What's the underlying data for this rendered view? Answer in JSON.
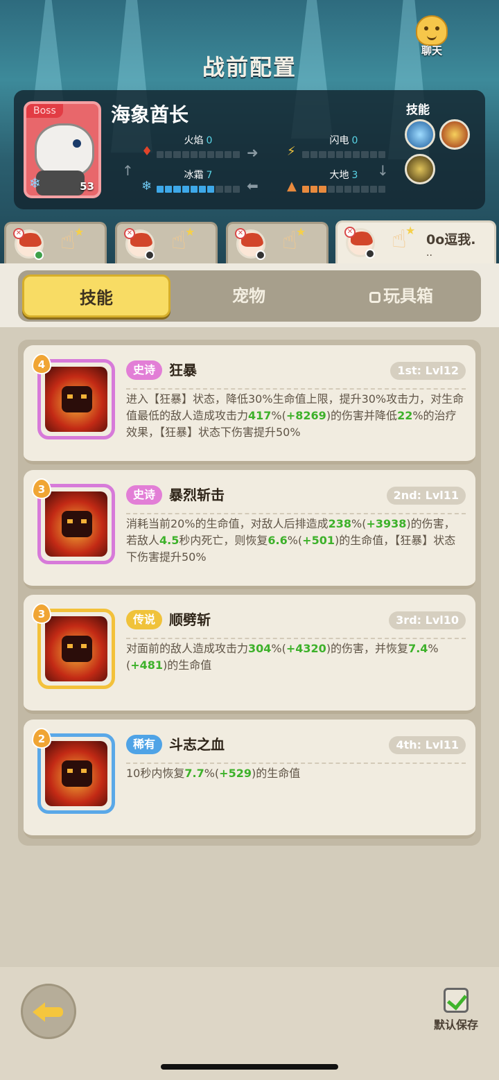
{
  "header": {
    "title": "战前配置",
    "chat_label": "聊天"
  },
  "boss": {
    "tag": "Boss",
    "name": "海象酋长",
    "level": "53",
    "skills_label": "技能",
    "stats": [
      {
        "label": "火焰",
        "value": "0",
        "filled": 0
      },
      {
        "label": "闪电",
        "value": "0",
        "filled": 0
      },
      {
        "label": "冰霜",
        "value": "7",
        "filled": 7
      },
      {
        "label": "大地",
        "value": "3",
        "filled": 3
      }
    ]
  },
  "heroes": [
    {
      "name": ""
    },
    {
      "name": ""
    },
    {
      "name": ""
    },
    {
      "name": "0o逗我.",
      "sub": ".."
    }
  ],
  "tabs": {
    "skills": "技能",
    "pets": "宠物",
    "toybox": "玩具箱"
  },
  "skills": [
    {
      "badge": "4",
      "rarity": "史诗",
      "rarity_color": "#e27ed6",
      "name": "狂暴",
      "level": "1st: Lvl12",
      "frame_color": "#d77ad9",
      "desc": [
        {
          "t": "进入【狂暴】状态，降低30%生命值上限，提升30%攻击力，对生命值最低的敌人造成攻击力"
        },
        {
          "t": "417",
          "g": true
        },
        {
          "t": "%("
        },
        {
          "t": "+8269",
          "g": true
        },
        {
          "t": ")的伤害并降低"
        },
        {
          "t": "22",
          "g": true
        },
        {
          "t": "%的治疗效果，【狂暴】状态下伤害提升50%"
        }
      ]
    },
    {
      "badge": "3",
      "rarity": "史诗",
      "rarity_color": "#e27ed6",
      "name": "暴烈斩击",
      "level": "2nd: Lvl11",
      "frame_color": "#d77ad9",
      "desc": [
        {
          "t": "消耗当前20%的生命值，对敌人后排造成"
        },
        {
          "t": "238",
          "g": true
        },
        {
          "t": "%("
        },
        {
          "t": "+3938",
          "g": true
        },
        {
          "t": ")的伤害，若敌人"
        },
        {
          "t": "4.5",
          "g": true
        },
        {
          "t": "秒内死亡，则恢复"
        },
        {
          "t": "6.6",
          "g": true
        },
        {
          "t": "%("
        },
        {
          "t": "+501",
          "g": true
        },
        {
          "t": ")的生命值，【狂暴】状态下伤害提升50%"
        }
      ]
    },
    {
      "badge": "3",
      "rarity": "传说",
      "rarity_color": "#f0c23a",
      "name": "顺劈斩",
      "level": "3rd: Lvl10",
      "frame_color": "#f3c13a",
      "desc": [
        {
          "t": "对面前的敌人造成攻击力"
        },
        {
          "t": "304",
          "g": true
        },
        {
          "t": "%("
        },
        {
          "t": "+4320",
          "g": true
        },
        {
          "t": ")的伤害，并恢复"
        },
        {
          "t": "7.4",
          "g": true
        },
        {
          "t": "%("
        },
        {
          "t": "+481",
          "g": true
        },
        {
          "t": ")的生命值"
        }
      ]
    },
    {
      "badge": "2",
      "rarity": "稀有",
      "rarity_color": "#4fa3e6",
      "name": "斗志之血",
      "level": "4th: Lvl11",
      "frame_color": "#5aa8e8",
      "desc": [
        {
          "t": "10秒内恢复"
        },
        {
          "t": "7.7",
          "g": true
        },
        {
          "t": "%("
        },
        {
          "t": "+529",
          "g": true
        },
        {
          "t": ")的生命值"
        }
      ]
    }
  ],
  "footer": {
    "save_label": "默认保存"
  }
}
